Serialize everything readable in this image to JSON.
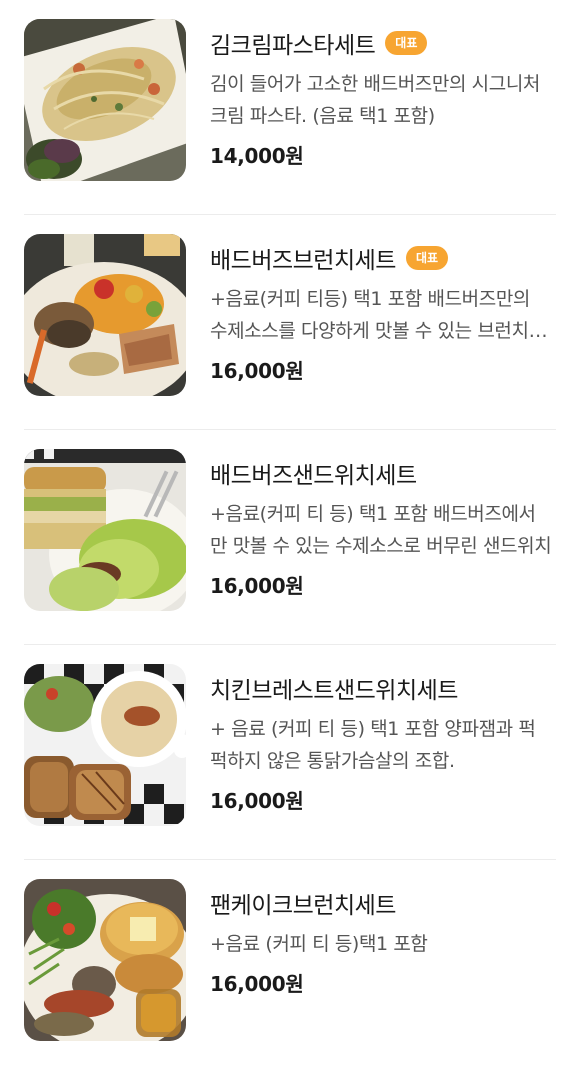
{
  "menu": {
    "items": [
      {
        "title": "김크림파스타세트",
        "badge": "대표",
        "description": "김이 들어가 고소한 배드버즈만의 시그니처 크림 파스타. (음료 택1 포함)",
        "price": "14,000원",
        "image_icon": "pasta-photo"
      },
      {
        "title": "배드버즈브런치세트",
        "badge": "대표",
        "description": "+음료(커피 티등) 택1 포함 배드버즈만의 수제소스를 다양하게 맛볼 수 있는 브런치 세트",
        "price": "16,000원",
        "image_icon": "brunch-plate-photo"
      },
      {
        "title": "배드버즈샌드위치세트",
        "badge": "",
        "description": "+음료(커피 티 등) 택1 포함 배드버즈에서만 맛볼 수 있는 수제소스로 버무린 샌드위치",
        "price": "16,000원",
        "image_icon": "sandwich-photo"
      },
      {
        "title": "치킨브레스트샌드위치세트",
        "badge": "",
        "description": "+ 음료 (커피 티 등) 택1 포함 양파잼과 퍽퍽하지 않은 통닭가슴살의 조합.",
        "price": "16,000원",
        "image_icon": "chicken-sandwich-soup-photo"
      },
      {
        "title": "팬케이크브런치세트",
        "badge": "",
        "description": "+음료 (커피 티 등)택1 포함",
        "price": "16,000원",
        "image_icon": "pancake-brunch-photo"
      }
    ]
  }
}
